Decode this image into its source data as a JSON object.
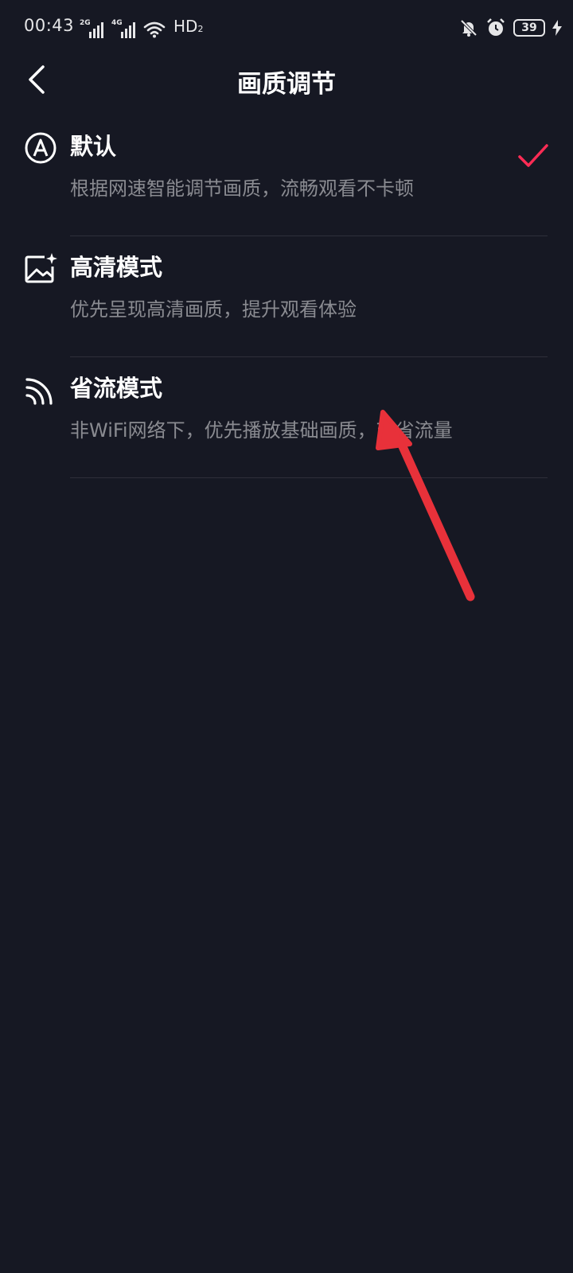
{
  "status_bar": {
    "time": "00:43",
    "signal1_gen": "2G",
    "signal2_gen": "4G",
    "hd_label": "HD",
    "hd_sub": "2",
    "battery_level": "39"
  },
  "header": {
    "title": "画质调节"
  },
  "options": [
    {
      "title": "默认",
      "desc": "根据网速智能调节画质，流畅观看不卡顿",
      "selected": true,
      "icon": "auto-a-icon"
    },
    {
      "title": "高清模式",
      "desc": "优先呈现高清画质，提升观看体验",
      "selected": false,
      "icon": "image-sparkle-icon"
    },
    {
      "title": "省流模式",
      "desc": "非WiFi网络下，优先播放基础画质，节省流量",
      "selected": false,
      "icon": "signal-waves-icon"
    }
  ],
  "colors": {
    "background": "#161823",
    "accent_check": "#fe2c55",
    "annotation_arrow": "#e8313a",
    "secondary_text": "#8a8b91"
  }
}
